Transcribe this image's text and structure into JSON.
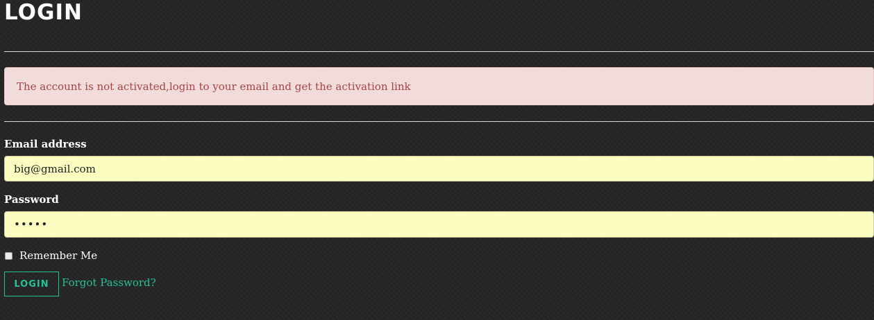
{
  "page": {
    "title": "LOGIN"
  },
  "alert": {
    "message": "The account is not activated,login to your email and get the activation link"
  },
  "form": {
    "email_label": "Email address",
    "email_value": "big@gmail.com",
    "password_label": "Password",
    "password_value": "•••••",
    "remember_label": "Remember Me",
    "remember_checked": false,
    "login_button_label": "LOGIN",
    "forgot_link_label": "Forgot Password?"
  },
  "colors": {
    "background": "#262626",
    "alert_background": "#f2dbdb",
    "alert_text": "#a94442",
    "input_background": "#fafdbf",
    "accent": "#26c09a"
  }
}
